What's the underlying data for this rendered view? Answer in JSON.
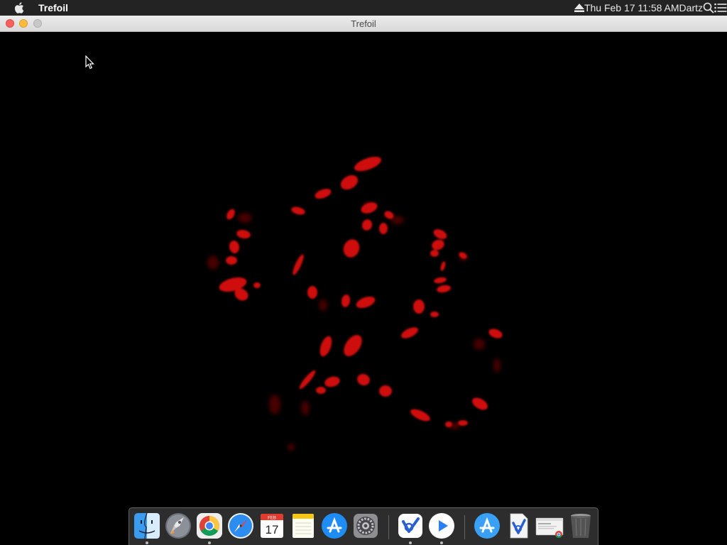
{
  "menubar": {
    "app_name": "Trefoil",
    "clock": "Thu Feb 17  11:58 AM",
    "user": "Dartz"
  },
  "window": {
    "title": "Trefoil"
  },
  "dock": {
    "calendar_month": "FEB",
    "calendar_day": "17",
    "items": [
      {
        "icon": "finder-icon",
        "running": true
      },
      {
        "icon": "launchpad-icon",
        "running": false
      },
      {
        "icon": "chrome-icon",
        "running": true
      },
      {
        "icon": "safari-icon",
        "running": false
      },
      {
        "icon": "calendar-icon",
        "running": false
      },
      {
        "icon": "notes-icon",
        "running": false
      },
      {
        "icon": "app-store-icon",
        "running": false
      },
      {
        "icon": "system-preferences-icon",
        "running": false
      },
      {
        "icon": "app-icon",
        "running": true
      },
      {
        "icon": "quicktime-icon",
        "running": true
      },
      {
        "icon": "app-store-folder-icon",
        "running": false
      },
      {
        "icon": "document-icon",
        "running": false
      },
      {
        "icon": "chrome-window-icon",
        "running": false
      },
      {
        "icon": "trash-icon",
        "running": false
      }
    ]
  },
  "colors": {
    "menubar_bg": "#232323",
    "shard_red": "#d01010",
    "shard_dark_red": "#6a0606"
  }
}
